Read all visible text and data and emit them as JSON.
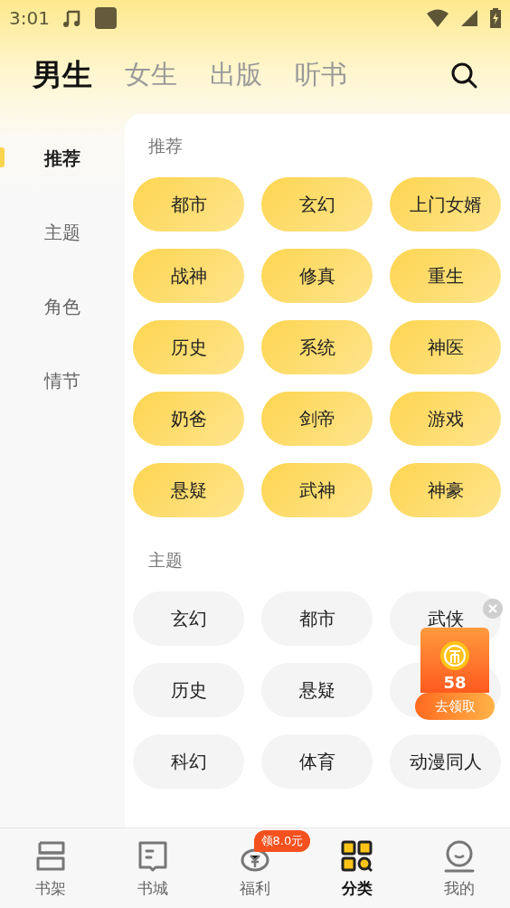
{
  "status_bar": {
    "time": "3:01"
  },
  "top_tabs": [
    {
      "label": "男生",
      "selected": true
    },
    {
      "label": "女生",
      "selected": false
    },
    {
      "label": "出版",
      "selected": false
    },
    {
      "label": "听书",
      "selected": false
    }
  ],
  "sidebar": {
    "items": [
      {
        "label": "推荐",
        "selected": true
      },
      {
        "label": "主题",
        "selected": false
      },
      {
        "label": "角色",
        "selected": false
      },
      {
        "label": "情节",
        "selected": false
      }
    ]
  },
  "sections": [
    {
      "title": "推荐",
      "highlighted": true,
      "tags": [
        {
          "kind": "tag",
          "label": "都市"
        },
        {
          "kind": "tag",
          "label": "玄幻"
        },
        {
          "kind": "tag",
          "label": "上门女婿"
        },
        {
          "kind": "tag",
          "label": "战神"
        },
        {
          "kind": "tag",
          "label": "修真"
        },
        {
          "kind": "tag",
          "label": "重生"
        },
        {
          "kind": "tag",
          "label": "历史"
        },
        {
          "kind": "tag",
          "label": "系统"
        },
        {
          "kind": "tag",
          "label": "神医"
        },
        {
          "kind": "tag",
          "label": "奶爸"
        },
        {
          "kind": "tag",
          "label": "剑帝"
        },
        {
          "kind": "tag",
          "label": "游戏"
        },
        {
          "kind": "tag",
          "label": "悬疑"
        },
        {
          "kind": "tag",
          "label": "武神"
        },
        {
          "kind": "tag",
          "label": "神豪"
        }
      ]
    },
    {
      "title": "主题",
      "highlighted": false,
      "tags": [
        {
          "kind": "tag",
          "label": "玄幻"
        },
        {
          "kind": "tag",
          "label": "都市"
        },
        {
          "kind": "tag",
          "label": "武侠"
        },
        {
          "kind": "tag",
          "label": "历史"
        },
        {
          "kind": "tag",
          "label": "悬疑"
        },
        {
          "kind": "covered"
        },
        {
          "kind": "tag",
          "label": "科幻"
        },
        {
          "kind": "tag",
          "label": "体育"
        },
        {
          "kind": "tag",
          "label": "动漫同人"
        }
      ]
    }
  ],
  "reward_popup": {
    "amount": "58",
    "button": "去领取"
  },
  "bottom_nav": [
    {
      "label": "书架",
      "selected": false
    },
    {
      "label": "书城",
      "selected": false
    },
    {
      "label": "福利",
      "selected": false,
      "badge": "领8.0元"
    },
    {
      "label": "分类",
      "selected": true
    },
    {
      "label": "我的",
      "selected": false
    }
  ]
}
